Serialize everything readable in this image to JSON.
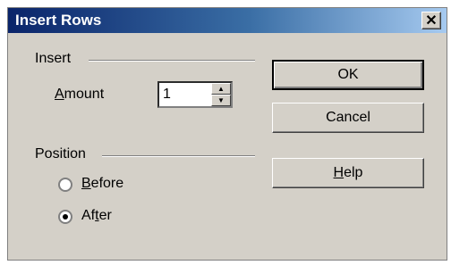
{
  "window": {
    "title": "Insert Rows",
    "close_glyph": "✕"
  },
  "insert_group": {
    "label": "Insert",
    "amount_label": "Amount",
    "amount_value": "1"
  },
  "position_group": {
    "label": "Position",
    "options": [
      {
        "label": "Before",
        "selected": false
      },
      {
        "label": "After",
        "selected": true
      }
    ]
  },
  "buttons": {
    "ok": "OK",
    "cancel": "Cancel",
    "help": "Help"
  },
  "spin": {
    "up_glyph": "▲",
    "down_glyph": "▼"
  }
}
